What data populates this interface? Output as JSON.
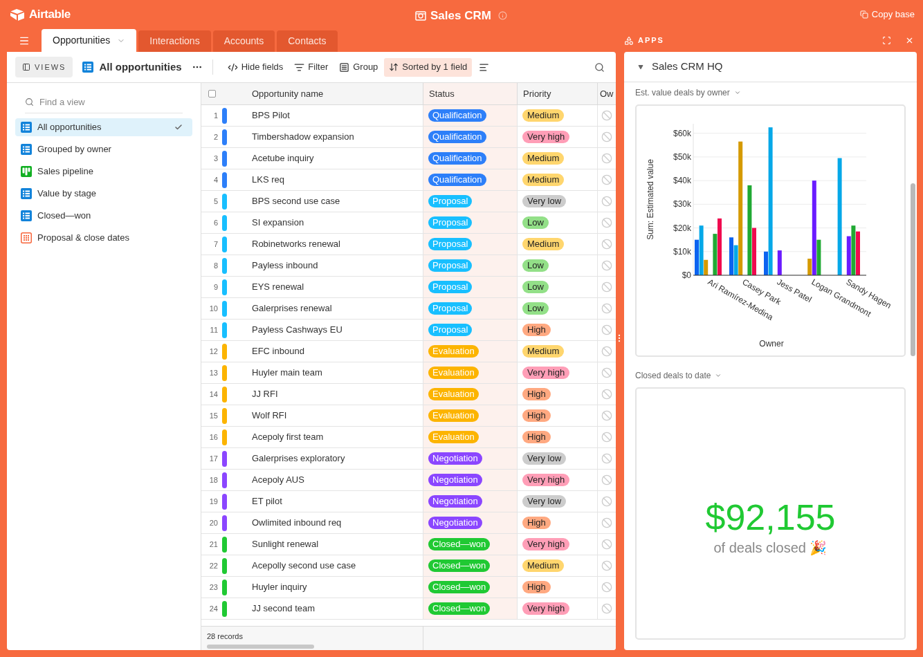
{
  "app": {
    "logo": "Airtable",
    "base_title": "Sales CRM",
    "copy_button": "Copy base"
  },
  "tabs": [
    {
      "label": "Opportunities",
      "selected": true
    },
    {
      "label": "Interactions",
      "selected": false
    },
    {
      "label": "Accounts",
      "selected": false
    },
    {
      "label": "Contacts",
      "selected": false
    }
  ],
  "toolbar": {
    "views_button": "VIEWS",
    "view_name": "All opportunities",
    "buttons": [
      {
        "label": "Hide fields",
        "kind": "hide",
        "active": false
      },
      {
        "label": "Filter",
        "kind": "filter",
        "active": false
      },
      {
        "label": "Group",
        "kind": "group",
        "active": false
      },
      {
        "label": "Sorted by 1 field",
        "kind": "sort",
        "active": true
      }
    ]
  },
  "sidebar": {
    "search_placeholder": "Find a view",
    "views": [
      {
        "label": "All opportunities",
        "kind": "grid",
        "selected": true
      },
      {
        "label": "Grouped by owner",
        "kind": "grid",
        "selected": false
      },
      {
        "label": "Sales pipeline",
        "kind": "kanban",
        "selected": false
      },
      {
        "label": "Value by stage",
        "kind": "grid",
        "selected": false
      },
      {
        "label": "Closed—won",
        "kind": "grid",
        "selected": false
      },
      {
        "label": "Proposal & close dates",
        "kind": "calendar",
        "selected": false
      }
    ]
  },
  "table": {
    "select_all": {
      "checked": false
    },
    "columns": [
      "Opportunity name",
      "Status",
      "Priority",
      "Ow"
    ],
    "rows": [
      {
        "number": "1",
        "name": "BPS Pilot",
        "status": {
          "label": "Qualification",
          "color": "#2d7ff9"
        },
        "priority": {
          "label": "Medium",
          "color": "#ffd66e"
        }
      },
      {
        "number": "2",
        "name": "Timbershadow expansion",
        "status": {
          "label": "Qualification",
          "color": "#2d7ff9"
        },
        "priority": {
          "label": "Very high",
          "color": "#ff9eb7"
        }
      },
      {
        "number": "3",
        "name": "Acetube inquiry",
        "status": {
          "label": "Qualification",
          "color": "#2d7ff9"
        },
        "priority": {
          "label": "Medium",
          "color": "#ffd66e"
        }
      },
      {
        "number": "4",
        "name": "LKS req",
        "status": {
          "label": "Qualification",
          "color": "#2d7ff9"
        },
        "priority": {
          "label": "Medium",
          "color": "#ffd66e"
        }
      },
      {
        "number": "5",
        "name": "BPS second use case",
        "status": {
          "label": "Proposal",
          "color": "#18bfff"
        },
        "priority": {
          "label": "Very low",
          "color": "#cccccc"
        }
      },
      {
        "number": "6",
        "name": "SI expansion",
        "status": {
          "label": "Proposal",
          "color": "#18bfff"
        },
        "priority": {
          "label": "Low",
          "color": "#93e088"
        }
      },
      {
        "number": "7",
        "name": "Robinetworks renewal",
        "status": {
          "label": "Proposal",
          "color": "#18bfff"
        },
        "priority": {
          "label": "Medium",
          "color": "#ffd66e"
        }
      },
      {
        "number": "8",
        "name": "Payless inbound",
        "status": {
          "label": "Proposal",
          "color": "#18bfff"
        },
        "priority": {
          "label": "Low",
          "color": "#93e088"
        }
      },
      {
        "number": "9",
        "name": "EYS renewal",
        "status": {
          "label": "Proposal",
          "color": "#18bfff"
        },
        "priority": {
          "label": "Low",
          "color": "#93e088"
        }
      },
      {
        "number": "10",
        "name": "Galerprises renewal",
        "status": {
          "label": "Proposal",
          "color": "#18bfff"
        },
        "priority": {
          "label": "Low",
          "color": "#93e088"
        }
      },
      {
        "number": "11",
        "name": "Payless Cashways EU",
        "status": {
          "label": "Proposal",
          "color": "#18bfff"
        },
        "priority": {
          "label": "High",
          "color": "#ffa981"
        }
      },
      {
        "number": "12",
        "name": "EFC inbound",
        "status": {
          "label": "Evaluation",
          "color": "#fcb400"
        },
        "priority": {
          "label": "Medium",
          "color": "#ffd66e"
        }
      },
      {
        "number": "13",
        "name": "Huyler main team",
        "status": {
          "label": "Evaluation",
          "color": "#fcb400"
        },
        "priority": {
          "label": "Very high",
          "color": "#ff9eb7"
        }
      },
      {
        "number": "14",
        "name": "JJ RFI",
        "status": {
          "label": "Evaluation",
          "color": "#fcb400"
        },
        "priority": {
          "label": "High",
          "color": "#ffa981"
        }
      },
      {
        "number": "15",
        "name": "Wolf RFI",
        "status": {
          "label": "Evaluation",
          "color": "#fcb400"
        },
        "priority": {
          "label": "High",
          "color": "#ffa981"
        }
      },
      {
        "number": "16",
        "name": "Acepoly first team",
        "status": {
          "label": "Evaluation",
          "color": "#fcb400"
        },
        "priority": {
          "label": "High",
          "color": "#ffa981"
        }
      },
      {
        "number": "17",
        "name": "Galerprises exploratory",
        "status": {
          "label": "Negotiation",
          "color": "#8b46ff"
        },
        "priority": {
          "label": "Very low",
          "color": "#cccccc"
        }
      },
      {
        "number": "18",
        "name": "Acepoly AUS",
        "status": {
          "label": "Negotiation",
          "color": "#8b46ff"
        },
        "priority": {
          "label": "Very high",
          "color": "#ff9eb7"
        }
      },
      {
        "number": "19",
        "name": "ET pilot",
        "status": {
          "label": "Negotiation",
          "color": "#8b46ff"
        },
        "priority": {
          "label": "Very low",
          "color": "#cccccc"
        }
      },
      {
        "number": "20",
        "name": "Owlimited inbound req",
        "status": {
          "label": "Negotiation",
          "color": "#8b46ff"
        },
        "priority": {
          "label": "High",
          "color": "#ffa981"
        }
      },
      {
        "number": "21",
        "name": "Sunlight renewal",
        "status": {
          "label": "Closed—won",
          "color": "#20c933"
        },
        "priority": {
          "label": "Very high",
          "color": "#ff9eb7"
        }
      },
      {
        "number": "22",
        "name": "Acepolly second use case",
        "status": {
          "label": "Closed—won",
          "color": "#20c933"
        },
        "priority": {
          "label": "Medium",
          "color": "#ffd66e"
        }
      },
      {
        "number": "23",
        "name": "Huyler inquiry",
        "status": {
          "label": "Closed—won",
          "color": "#20c933"
        },
        "priority": {
          "label": "High",
          "color": "#ffa981"
        }
      },
      {
        "number": "24",
        "name": "JJ second team",
        "status": {
          "label": "Closed—won",
          "color": "#20c933"
        },
        "priority": {
          "label": "Very high",
          "color": "#ff9eb7"
        }
      }
    ],
    "footer": "28 records"
  },
  "apps": {
    "label": "APPS",
    "dashboard": {
      "title": "Sales CRM HQ",
      "expanded": true
    },
    "chart": {
      "title": "Est. value deals by owner",
      "chart_data": {
        "type": "bar",
        "xlabel": "Owner",
        "ylabel": "Sum: Estimated value",
        "categories": [
          "Ari Ramírez-Medina",
          "Casey Park",
          "Jess Patel",
          "Logan Grandmont",
          "Sandy Hagen"
        ],
        "series": [
          {
            "color": "#0b63f0",
            "values": [
              15000,
              16000,
              10000,
              null,
              null
            ]
          },
          {
            "color": "#05a8e8",
            "values": [
              21000,
              12700,
              62500,
              null,
              49500
            ]
          },
          {
            "color": "#d59a00",
            "values": [
              6500,
              56500,
              null,
              7000,
              null
            ]
          },
          {
            "color": "#6a1bff",
            "values": [
              null,
              null,
              10500,
              40000,
              16500
            ]
          },
          {
            "color": "#20a933",
            "values": [
              17500,
              38000,
              null,
              15000,
              21000
            ]
          },
          {
            "color": "#f0094f",
            "values": [
              24000,
              20000,
              null,
              null,
              18500
            ]
          }
        ],
        "ylim": [
          0,
          64000
        ],
        "grid": true,
        "yticks": [
          {
            "value": 0,
            "label": "$0"
          },
          {
            "value": 10000,
            "label": "$10k"
          },
          {
            "value": 20000,
            "label": "$20k"
          },
          {
            "value": 30000,
            "label": "$30k"
          },
          {
            "value": 40000,
            "label": "$40k"
          },
          {
            "value": 50000,
            "label": "$50k"
          },
          {
            "value": 60000,
            "label": "$60k"
          }
        ]
      }
    },
    "summary": {
      "title": "Closed deals to date",
      "value": "$92,155",
      "caption": "of deals closed 🎉"
    }
  }
}
